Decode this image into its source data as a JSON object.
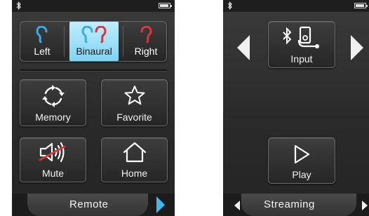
{
  "colors": {
    "accent_blue": "#3fb8f2",
    "ear_left": "#3aa9e6",
    "ear_right": "#e0343a",
    "selected_bg": "#9fe0f8",
    "mute_slash": "#e0343a"
  },
  "remote_screen": {
    "ear_selector": {
      "left_label": "Left",
      "binaural_label": "Binaural",
      "right_label": "Right",
      "selected": "Binaural"
    },
    "buttons": {
      "memory_label": "Memory",
      "favorite_label": "Favorite",
      "mute_label": "Mute",
      "home_label": "Home"
    },
    "tab_title": "Remote"
  },
  "streaming_screen": {
    "input_label": "Input",
    "play_label": "Play",
    "tab_title": "Streaming"
  },
  "icons": [
    "bluetooth-icon",
    "battery-icon",
    "ear-icon",
    "refresh-icon",
    "star-icon",
    "speaker-mute-icon",
    "home-icon",
    "music-player-icon",
    "play-icon",
    "arrow-left-icon",
    "arrow-right-icon"
  ]
}
